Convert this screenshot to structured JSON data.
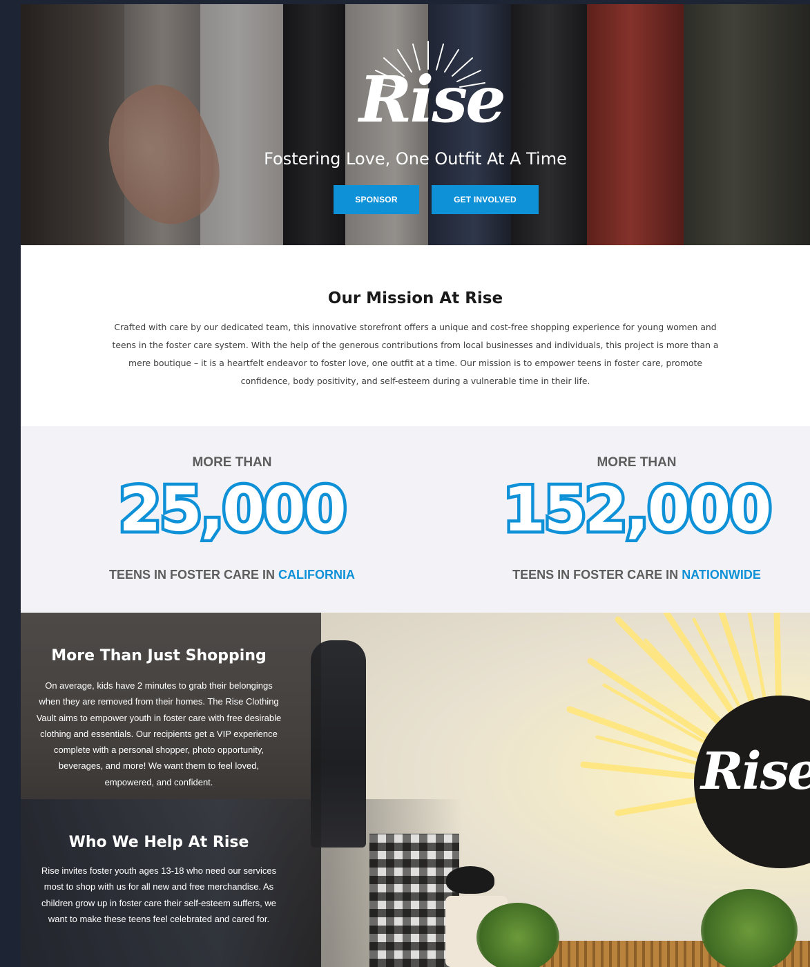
{
  "hero": {
    "logo_text": "Rise",
    "tagline": "Fostering Love, One Outfit At A Time",
    "buttons": {
      "sponsor": "SPONSOR",
      "get_involved": "GET INVOLVED"
    }
  },
  "mission": {
    "title": "Our Mission At Rise",
    "text": "Crafted with care by our dedicated team, this innovative storefront offers a unique and cost-free shopping experience for young women and teens in the foster care system. With the help of the generous contributions from local businesses and individuals, this project is more than a mere boutique – it is a heartfelt endeavor to foster love, one outfit at a time. Our mission is to empower teens in foster care, promote confidence, body positivity, and self-esteem during a vulnerable time in their life."
  },
  "stats": [
    {
      "prefix": "MORE THAN",
      "value": "25,000",
      "label": "TEENS IN FOSTER CARE IN ",
      "highlight": "CALIFORNIA"
    },
    {
      "prefix": "MORE THAN",
      "value": "152,000",
      "label": "TEENS IN FOSTER CARE IN ",
      "highlight": "NATIONWIDE"
    }
  ],
  "shopping": {
    "heading": "More Than Just Shopping",
    "text": "On average, kids have 2 minutes to grab their belongings when they are removed from their homes. The Rise Clothing Vault aims to empower youth in foster care with free desirable clothing and essentials. Our recipients get a VIP experience complete with a personal shopper, photo opportunity, beverages, and more! We want them to feel loved, empowered, and confident.",
    "help_heading": "Who We Help At Rise",
    "help_text": "Rise invites foster youth ages 13-18 who need our services most to shop with us for all new and free merchandise. As children grow up in foster care their self-esteem suffers, we want to make these teens feel celebrated and cared for.",
    "sign_text": "Rise"
  },
  "colors": {
    "accent": "#0f91d8",
    "page_background": "#1d2433",
    "stats_background": "#f3f3f7",
    "stat_text": "#5d5d5d"
  }
}
